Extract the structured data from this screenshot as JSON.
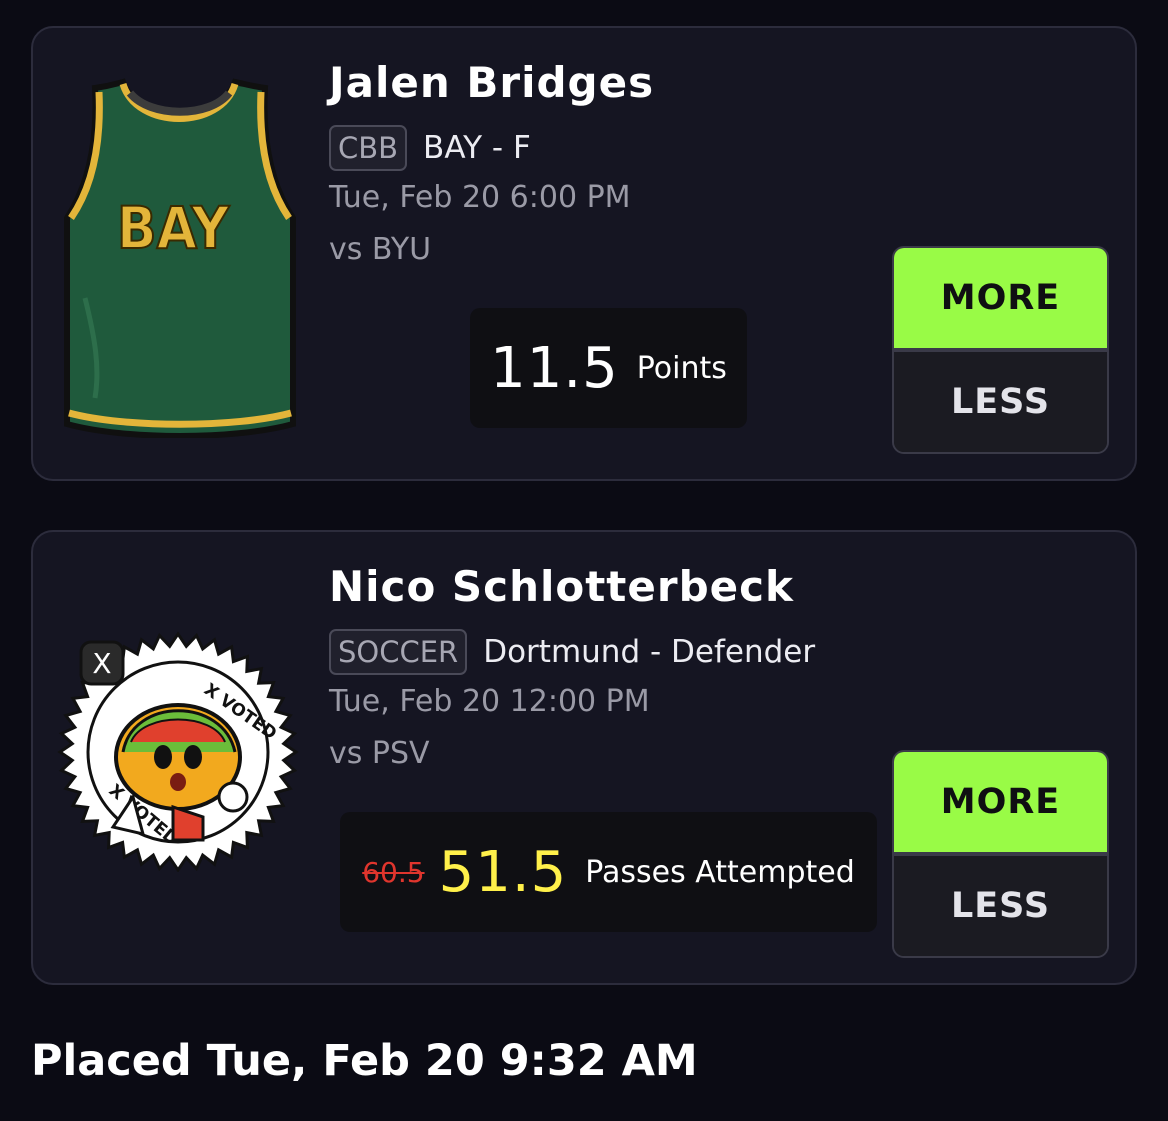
{
  "picks": [
    {
      "player_name": "Jalen Bridges",
      "league": "CBB",
      "team_position": "BAY - F",
      "game_time": "Tue, Feb 20 6:00 PM",
      "opponent": "vs BYU",
      "avatar": {
        "type": "jersey-icon",
        "text": "BAY",
        "color": "#1f5a3c",
        "trim": "#e3b53a"
      },
      "line_value": "11.5",
      "stat_label": "Points",
      "more_label": "MORE",
      "less_label": "LESS"
    },
    {
      "player_name": "Nico Schlotterbeck",
      "league": "SOCCER",
      "team_position": "Dortmund - Defender",
      "game_time": "Tue, Feb 20 12:00 PM",
      "opponent": "vs PSV",
      "avatar": {
        "type": "x-voted-taco-badge-icon",
        "badge_text": "X VOTED"
      },
      "old_line_value": "60.5",
      "line_value": "51.5",
      "stat_label": "Passes Attempted",
      "more_label": "MORE",
      "less_label": "LESS"
    }
  ],
  "placed_text": "Placed Tue, Feb 20 9:32 AM",
  "colors": {
    "background": "#0b0b14",
    "card": "#151522",
    "more_accent": "#99fb46",
    "discount_value": "#fff04a",
    "strike_red": "#e0352d"
  }
}
